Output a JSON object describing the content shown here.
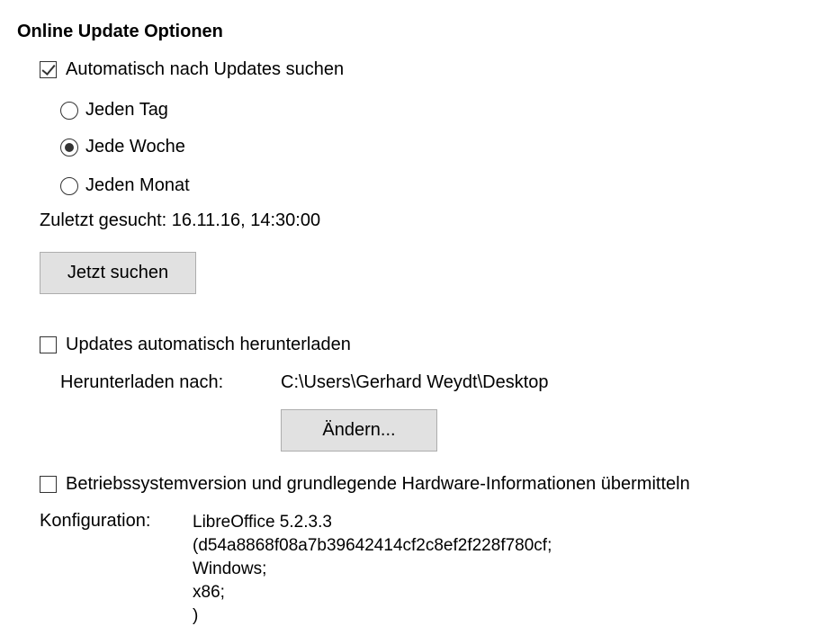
{
  "section": {
    "title": "Online Update Optionen"
  },
  "auto_check": {
    "label": "Automatisch nach Updates suchen",
    "checked": true
  },
  "frequency": {
    "daily": {
      "label": "Jeden Tag",
      "selected": false
    },
    "weekly": {
      "label": "Jede Woche",
      "selected": true
    },
    "monthly": {
      "label": "Jeden Monat",
      "selected": false
    }
  },
  "last_checked": {
    "text": "Zuletzt gesucht: 16.11.16, 14:30:00"
  },
  "check_now_button": {
    "label": "Jetzt suchen"
  },
  "auto_download": {
    "label": "Updates automatisch herunterladen",
    "checked": false
  },
  "download_to": {
    "label": "Herunterladen nach:",
    "path": "C:\\Users\\Gerhard Weydt\\Desktop"
  },
  "change_button": {
    "label": "Ändern..."
  },
  "send_os_info": {
    "label": "Betriebssystemversion und grundlegende Hardware-Informationen übermitteln",
    "checked": false
  },
  "configuration": {
    "label": "Konfiguration:",
    "lines": [
      "LibreOffice 5.2.3.3",
      "(d54a8868f08a7b39642414cf2c8ef2f228f780cf;",
      " Windows;",
      " x86;",
      " )"
    ]
  }
}
